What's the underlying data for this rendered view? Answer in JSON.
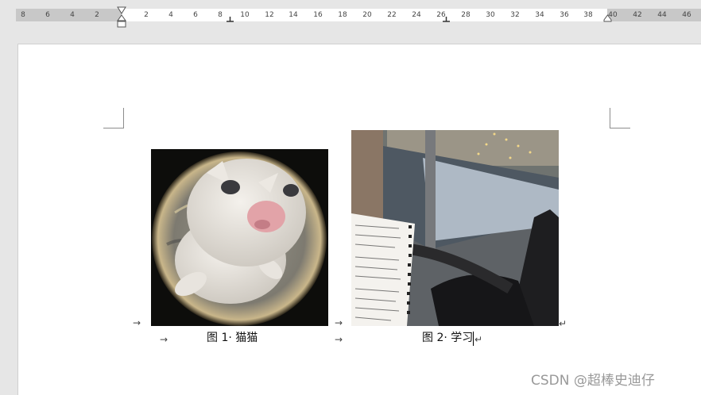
{
  "ruler": {
    "left_labels": [
      "8",
      "6",
      "4",
      "2"
    ],
    "right_labels": [
      "2",
      "4",
      "6",
      "8",
      "10",
      "12",
      "14",
      "16",
      "18",
      "20",
      "22",
      "24",
      "26",
      "28",
      "30",
      "32",
      "34",
      "36",
      "38",
      "40",
      "42",
      "44",
      "46"
    ]
  },
  "document": {
    "figure1": {
      "caption": "图 1· 猫猫",
      "image": "cat-fisheye-photo"
    },
    "figure2": {
      "caption": "图 2· 学习",
      "image": "notebook-window-photo"
    },
    "tab_arrow": "→",
    "paragraph_mark": "↵"
  },
  "watermark": "CSDN @超棒史迪仔",
  "colors": {
    "ruler_gray": "#c8c8c8",
    "page": "#ffffff",
    "background": "#e6e6e6"
  }
}
